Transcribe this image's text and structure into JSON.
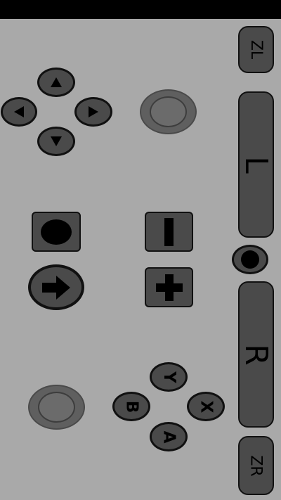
{
  "shoulders": {
    "zl_label": "ZL",
    "l_label": "L",
    "r_label": "R",
    "zr_label": "ZR"
  },
  "face_buttons": {
    "y_label": "Y",
    "x_label": "X",
    "b_label": "B",
    "a_label": "A"
  },
  "icons": {
    "dpad_up": "triangle-up-icon",
    "dpad_down": "triangle-down-icon",
    "dpad_left": "triangle-left-icon",
    "dpad_right": "triangle-right-icon",
    "capture": "circle-icon",
    "minus": "minus-icon",
    "home": "arrow-right-icon",
    "plus": "plus-icon"
  },
  "colors": {
    "background": "#a9a9a9",
    "button_fill": "#4a4a4a",
    "outline": "#111111",
    "status_bar": "#000000"
  }
}
